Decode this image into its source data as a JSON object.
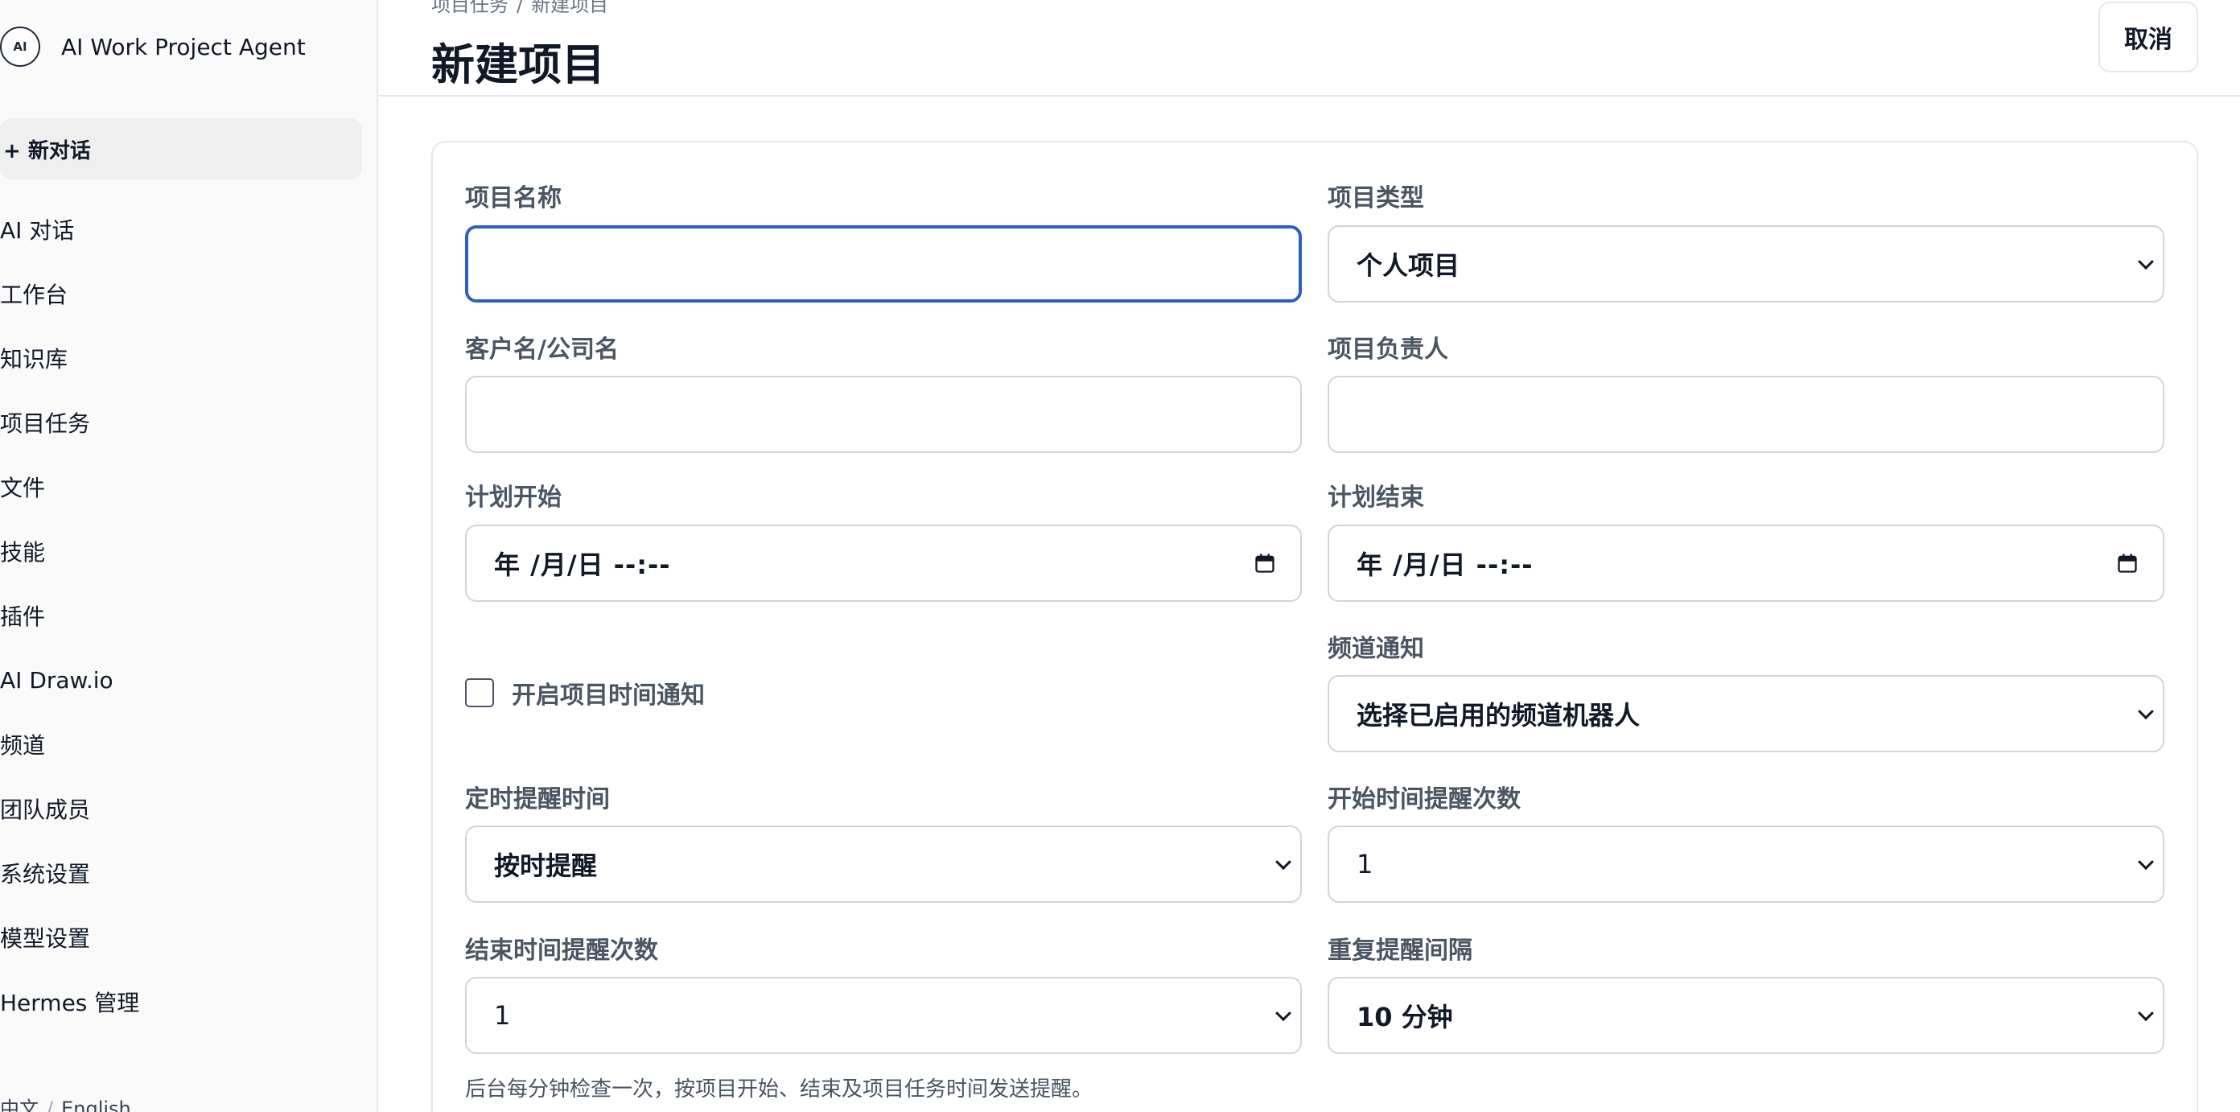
{
  "sidebar": {
    "brand_logo": "AI",
    "brand_name": "AI Work Project Agent",
    "new_chat": "+ 新对话",
    "items": [
      {
        "label": "AI 对话"
      },
      {
        "label": "工作台"
      },
      {
        "label": "知识库"
      },
      {
        "label": "项目任务"
      },
      {
        "label": "文件"
      },
      {
        "label": "技能"
      },
      {
        "label": "插件"
      },
      {
        "label": "AI Draw.io"
      },
      {
        "label": "频道"
      },
      {
        "label": "团队成员"
      },
      {
        "label": "系统设置"
      },
      {
        "label": "模型设置"
      },
      {
        "label": "Hermes 管理"
      }
    ],
    "lang": {
      "zh": "中文",
      "sep": "/",
      "en": "English"
    }
  },
  "header": {
    "breadcrumb": {
      "parent": "项目任务",
      "sep": "/",
      "current": "新建项目"
    },
    "title": "新建项目",
    "cancel_label": "取消"
  },
  "form": {
    "project_name": {
      "label": "项目名称",
      "value": ""
    },
    "project_type": {
      "label": "项目类型",
      "value": "个人项目"
    },
    "client_name": {
      "label": "客户名/公司名",
      "value": ""
    },
    "project_owner": {
      "label": "项目负责人",
      "value": ""
    },
    "plan_start": {
      "label": "计划开始",
      "value": "年 /月/日 --:--"
    },
    "plan_end": {
      "label": "计划结束",
      "value": "年 /月/日 --:--"
    },
    "enable_notify": {
      "label": "开启项目时间通知",
      "checked": false
    },
    "channel_notify": {
      "label": "频道通知",
      "value": "选择已启用的频道机器人"
    },
    "reminder_time": {
      "label": "定时提醒时间",
      "value": "按时提醒"
    },
    "start_reminder_count": {
      "label": "开始时间提醒次数",
      "value": "1"
    },
    "end_reminder_count": {
      "label": "结束时间提醒次数",
      "value": "1"
    },
    "repeat_interval": {
      "label": "重复提醒间隔",
      "value": "10 分钟"
    },
    "hint": "后台每分钟检查一次，按项目开始、结束及项目任务时间发送提醒。"
  },
  "colors": {
    "focus_border": "#2c5fc4",
    "sidebar_bg": "#fafafa"
  }
}
